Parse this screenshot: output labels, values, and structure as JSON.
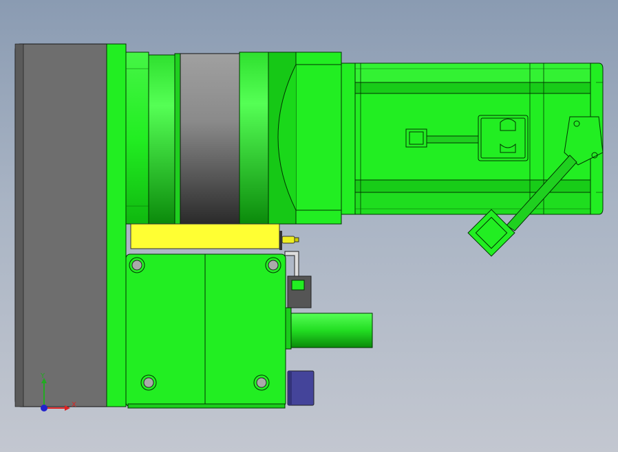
{
  "viewport": {
    "background_top": "#8a9bb2",
    "background_bottom": "#c3c7d0"
  },
  "colors": {
    "part_green": "#22ee22",
    "part_green_dark": "#0a9a0a",
    "plate_gray": "#6e6e6e",
    "cylinder_gray": "#8a8a8a",
    "yellow_block": "#ffff33",
    "blue_block": "#44449a",
    "edge": "#003300"
  },
  "triad": {
    "y_label": "Y",
    "x_label": "X",
    "y_color": "#22aa22",
    "x_color": "#dd2222",
    "origin_color": "#2222cc"
  }
}
